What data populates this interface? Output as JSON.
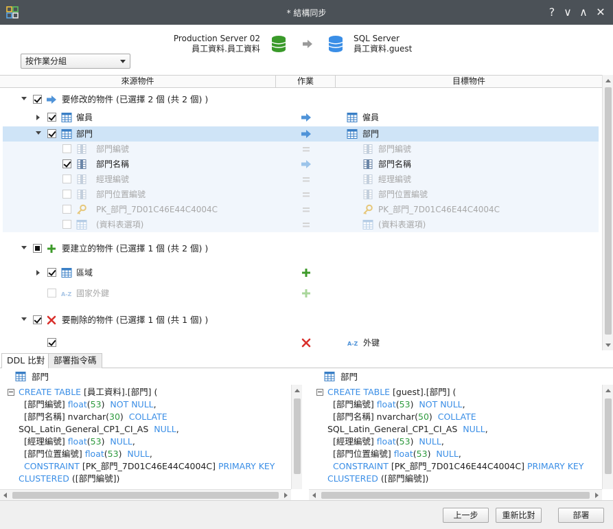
{
  "window": {
    "title": "* 結構同步",
    "controls": [
      "?",
      "∨",
      "∧",
      "✕"
    ]
  },
  "connection": {
    "source_server": "Production Server 02",
    "source_schema": "員工資料.員工資料",
    "target_server": "SQL Server",
    "target_schema": "員工資料.guest",
    "source_color": "#3a9a2a",
    "target_color": "#3a8ee6"
  },
  "group_by": {
    "selected": "按作業分組"
  },
  "grid": {
    "columns": {
      "source": "來源物件",
      "action": "作業",
      "target": "目標物件"
    },
    "groups": {
      "modify": {
        "label": "要修改的物件 (已選擇 2 個 (共 2 個) )",
        "icon": "arrow-right-icon"
      },
      "create": {
        "label": "要建立的物件 (已選擇 1 個 (共 2 個) )",
        "icon": "plus-icon"
      },
      "delete": {
        "label": "要刪除的物件 (已選擇 1 個 (共 1 個) )",
        "icon": "cross-icon"
      }
    },
    "rows": {
      "employee": {
        "source": "僱員",
        "target": "僱員"
      },
      "department": {
        "source": "部門",
        "target": "部門"
      },
      "dept_id": {
        "source": "部門編號",
        "target": "部門編號"
      },
      "dept_name": {
        "source": "部門名稱",
        "target": "部門名稱"
      },
      "manager_id": {
        "source": "經理編號",
        "target": "經理編號"
      },
      "location_id": {
        "source": "部門位置編號",
        "target": "部門位置編號"
      },
      "pk": {
        "source": "PK_部門_7D01C46E44C4004C",
        "target": "PK_部門_7D01C46E44C4004C"
      },
      "table_opts": {
        "source": "(資料表選項)",
        "target": "(資料表選項)"
      },
      "region": {
        "source": "區域"
      },
      "country_fk": {
        "source": "國家外鍵"
      },
      "fk_delete": {
        "target": "外键"
      }
    }
  },
  "tabs": {
    "ddl": "DDL 比對",
    "deploy": "部署指令碼"
  },
  "ddl": {
    "left": {
      "object": "部門",
      "lines": [
        [
          {
            "t": "CREATE TABLE",
            "c": "kw"
          },
          {
            "t": " [員工資料].[部門] ("
          }
        ],
        [
          {
            "t": "  [部門編號] "
          },
          {
            "t": "float",
            "c": "kw"
          },
          {
            "t": "("
          },
          {
            "t": "53",
            "c": "num"
          },
          {
            "t": ")  "
          },
          {
            "t": "NOT NULL",
            "c": "kw"
          },
          {
            "t": ","
          }
        ],
        [
          {
            "t": "  [部門名稱] nvarchar("
          },
          {
            "t": "30",
            "c": "num"
          },
          {
            "t": ")  "
          },
          {
            "t": "COLLATE",
            "c": "kw"
          }
        ],
        [
          {
            "t": "SQL_Latin_General_CP1_CI_AS  "
          },
          {
            "t": "NULL",
            "c": "kw"
          },
          {
            "t": ","
          }
        ],
        [
          {
            "t": "  [經理編號] "
          },
          {
            "t": "float",
            "c": "kw"
          },
          {
            "t": "("
          },
          {
            "t": "53",
            "c": "num"
          },
          {
            "t": ")  "
          },
          {
            "t": "NULL",
            "c": "kw"
          },
          {
            "t": ","
          }
        ],
        [
          {
            "t": "  [部門位置編號] "
          },
          {
            "t": "float",
            "c": "kw"
          },
          {
            "t": "("
          },
          {
            "t": "53",
            "c": "num"
          },
          {
            "t": ")  "
          },
          {
            "t": "NULL",
            "c": "kw"
          },
          {
            "t": ","
          }
        ],
        [
          {
            "t": "  "
          },
          {
            "t": "CONSTRAINT",
            "c": "kw"
          },
          {
            "t": " [PK_部門_7D01C46E44C4004C] "
          },
          {
            "t": "PRIMARY KEY",
            "c": "kw"
          }
        ],
        [
          {
            "t": "CLUSTERED",
            "c": "kw"
          },
          {
            "t": " ([部門編號])"
          }
        ]
      ]
    },
    "right": {
      "object": "部門",
      "lines": [
        [
          {
            "t": "CREATE TABLE",
            "c": "kw"
          },
          {
            "t": " [guest].[部門] ("
          }
        ],
        [
          {
            "t": "  [部門編號] "
          },
          {
            "t": "float",
            "c": "kw"
          },
          {
            "t": "("
          },
          {
            "t": "53",
            "c": "num"
          },
          {
            "t": ")  "
          },
          {
            "t": "NOT NULL",
            "c": "kw"
          },
          {
            "t": ","
          }
        ],
        [
          {
            "t": "  [部門名稱] nvarchar("
          },
          {
            "t": "50",
            "c": "num"
          },
          {
            "t": ")  "
          },
          {
            "t": "COLLATE",
            "c": "kw"
          }
        ],
        [
          {
            "t": "SQL_Latin_General_CP1_CI_AS  "
          },
          {
            "t": "NULL",
            "c": "kw"
          },
          {
            "t": ","
          }
        ],
        [
          {
            "t": "  [經理編號] "
          },
          {
            "t": "float",
            "c": "kw"
          },
          {
            "t": "("
          },
          {
            "t": "53",
            "c": "num"
          },
          {
            "t": ")  "
          },
          {
            "t": "NULL",
            "c": "kw"
          },
          {
            "t": ","
          }
        ],
        [
          {
            "t": "  [部門位置編號] "
          },
          {
            "t": "float",
            "c": "kw"
          },
          {
            "t": "("
          },
          {
            "t": "53",
            "c": "num"
          },
          {
            "t": ")  "
          },
          {
            "t": "NULL",
            "c": "kw"
          },
          {
            "t": ","
          }
        ],
        [
          {
            "t": "  "
          },
          {
            "t": "CONSTRAINT",
            "c": "kw"
          },
          {
            "t": " [PK_部門_7D01C46E44C4004C] "
          },
          {
            "t": "PRIMARY KEY",
            "c": "kw"
          }
        ],
        [
          {
            "t": "CLUSTERED",
            "c": "kw"
          },
          {
            "t": " ([部門編號])"
          }
        ]
      ]
    }
  },
  "buttons": {
    "back": "上一步",
    "recompare": "重新比對",
    "deploy": "部署"
  }
}
